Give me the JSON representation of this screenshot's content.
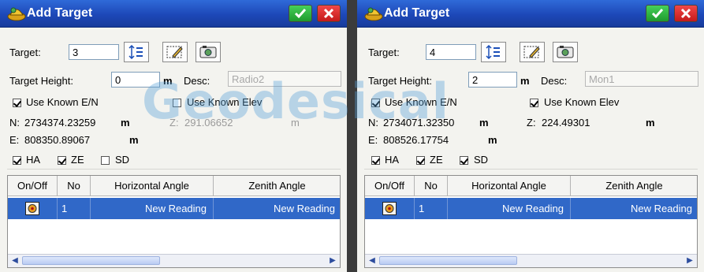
{
  "watermark": "Geodesical",
  "panels": [
    {
      "title": "Add Target",
      "target_label": "Target:",
      "target_value": "3",
      "height_label": "Target Height:",
      "height_value": "0",
      "height_unit": "m",
      "desc_label": "Desc:",
      "desc_value": "Radio2",
      "use_known_en": "Use Known E/N",
      "use_known_elev": "Use Known Elev",
      "elev_checked": false,
      "n_label": "N:",
      "n_value": "2734374.23259",
      "n_unit": "m",
      "z_label": "Z:",
      "z_value": "291.06652",
      "z_unit": "m",
      "e_label": "E:",
      "e_value": "808350.89067",
      "e_unit": "m",
      "ha": "HA",
      "ze": "ZE",
      "sd": "SD",
      "sd_checked": false,
      "columns": [
        "On/Off",
        "No",
        "Horizontal Angle",
        "Zenith Angle"
      ],
      "row": {
        "no": "1",
        "horizontal": "New Reading",
        "zenith": "New Reading"
      }
    },
    {
      "title": "Add Target",
      "target_label": "Target:",
      "target_value": "4",
      "height_label": "Target Height:",
      "height_value": "2",
      "height_unit": "m",
      "desc_label": "Desc:",
      "desc_value": "Mon1",
      "use_known_en": "Use Known E/N",
      "use_known_elev": "Use Known Elev",
      "elev_checked": true,
      "n_label": "N:",
      "n_value": "2734071.32350",
      "n_unit": "m",
      "z_label": "Z:",
      "z_value": "224.49301",
      "z_unit": "m",
      "e_label": "E:",
      "e_value": "808526.17754",
      "e_unit": "m",
      "ha": "HA",
      "ze": "ZE",
      "sd": "SD",
      "sd_checked": true,
      "columns": [
        "On/Off",
        "No",
        "Horizontal Angle",
        "Zenith Angle"
      ],
      "row": {
        "no": "1",
        "horizontal": "New Reading",
        "zenith": "New Reading"
      }
    }
  ],
  "colors": {
    "titlebar": "#1d48b8",
    "selected_row": "#3068c8",
    "ok": "#1e9a2d",
    "close": "#c41a1a"
  },
  "icons": [
    "app-icon",
    "ok-check-icon",
    "close-x-icon",
    "list-icon",
    "edit-icon",
    "camera-icon",
    "target-toggle-icon",
    "scroll-left-icon",
    "scroll-right-icon"
  ]
}
